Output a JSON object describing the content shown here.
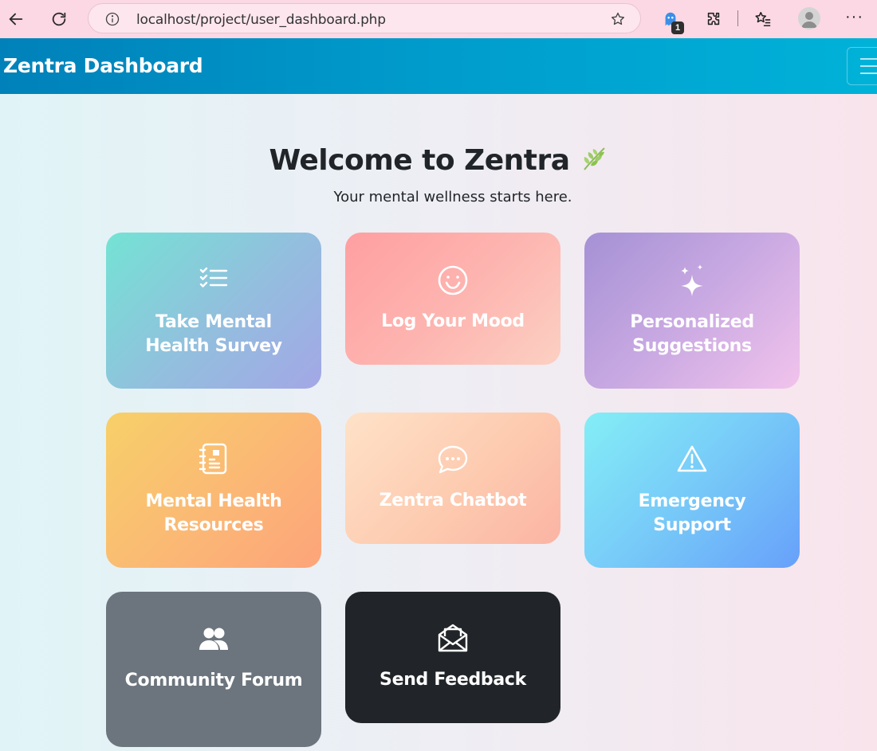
{
  "browser": {
    "url": "localhost/project/user_dashboard.php",
    "extension_badge": "1"
  },
  "header": {
    "brand": "Zentra Dashboard"
  },
  "main": {
    "title": "Welcome to Zentra",
    "subtitle": "Your mental wellness starts here."
  },
  "cards": [
    {
      "label": "Take Mental Health Survey",
      "icon": "checklist-icon"
    },
    {
      "label": "Log Your Mood",
      "icon": "smiley-icon"
    },
    {
      "label": "Personalized Suggestions",
      "icon": "sparkles-icon"
    },
    {
      "label": "Mental Health Resources",
      "icon": "journal-icon"
    },
    {
      "label": "Zentra Chatbot",
      "icon": "chat-icon"
    },
    {
      "label": "Emergency Support",
      "icon": "warning-icon"
    },
    {
      "label": "Community Forum",
      "icon": "people-icon"
    },
    {
      "label": "Send Feedback",
      "icon": "envelope-icon"
    }
  ],
  "colors": {
    "header_start": "#0081b9",
    "header_end": "#00b2d8",
    "browser_bar": "#fbd8e4"
  }
}
